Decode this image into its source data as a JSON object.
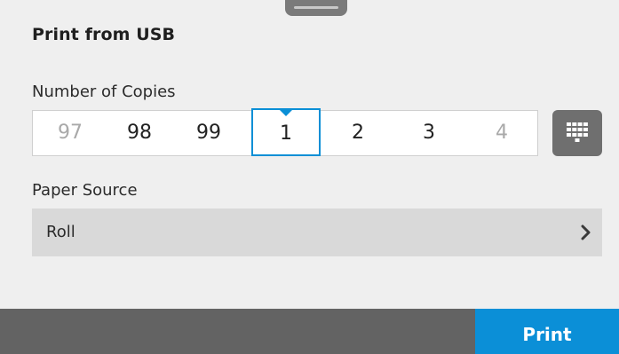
{
  "screen": {
    "title": "Print from USB",
    "copies": {
      "label": "Number of Copies",
      "values": [
        "97",
        "98",
        "99",
        "1",
        "2",
        "3",
        "4"
      ],
      "selected": "1"
    },
    "paper_source": {
      "label": "Paper Source",
      "value": "Roll"
    },
    "footer": {
      "print_label": "Print"
    }
  },
  "icons": {
    "keypad": "keypad-icon",
    "chevron": "chevron-right-icon",
    "handle": "drag-handle"
  },
  "colors": {
    "accent": "#0b8fd7",
    "footer": "#636363",
    "background": "#efefef"
  }
}
